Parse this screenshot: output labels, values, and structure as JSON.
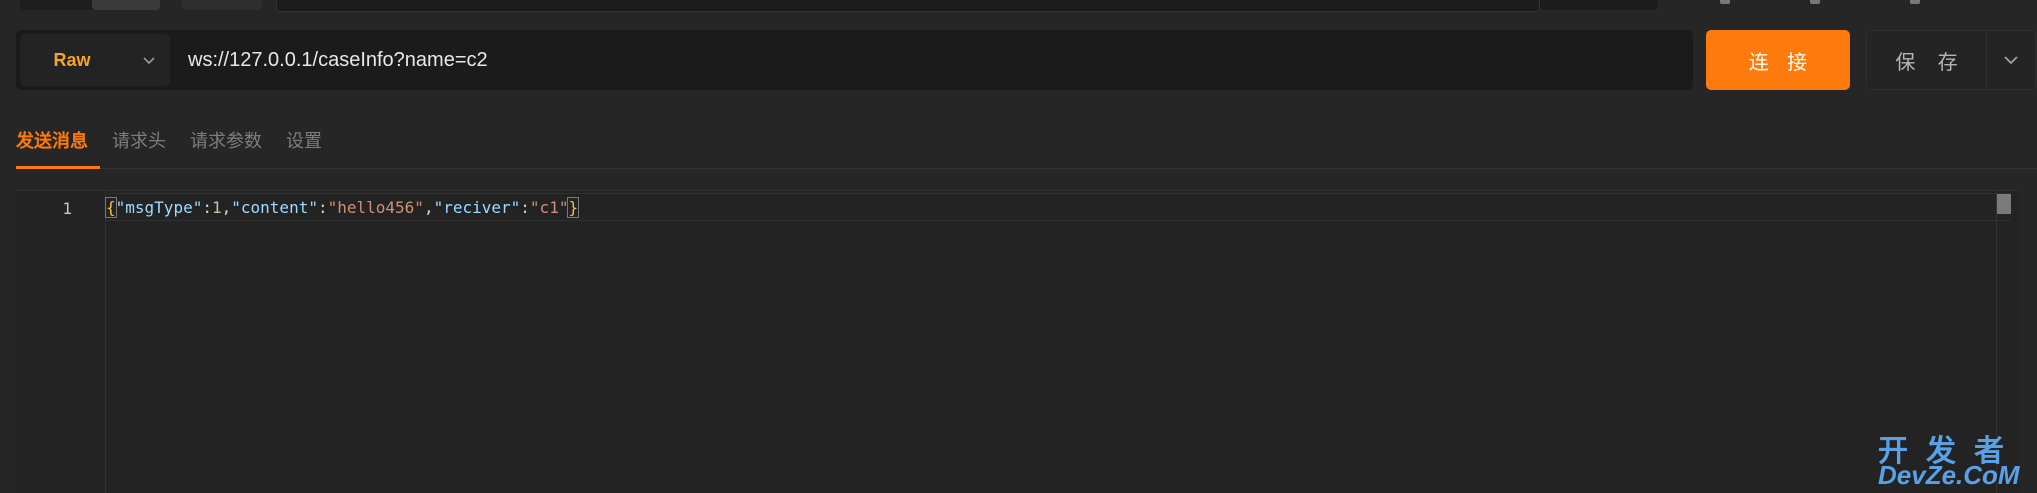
{
  "request": {
    "method": "Raw",
    "url": "ws://127.0.0.1/caseInfo?name=c2",
    "connect_label": "连 接",
    "save_label": "保 存"
  },
  "tabs": [
    {
      "label": "发送消息",
      "active": true
    },
    {
      "label": "请求头",
      "active": false
    },
    {
      "label": "请求参数",
      "active": false
    },
    {
      "label": "设置",
      "active": false
    }
  ],
  "editor": {
    "line_number": "1",
    "tokens": {
      "open": "{",
      "k1": "\"msgType\"",
      "c1": ":",
      "v1": "1",
      "s1": ",",
      "k2": "\"content\"",
      "c2": ":",
      "v2": "\"hello456\"",
      "s2": ",",
      "k3": "\"reciver\"",
      "c3": ":",
      "v3": "\"c1\"",
      "close": "}"
    }
  },
  "watermark": {
    "top": "开发者",
    "bottom": "DevZe.CoM"
  },
  "colors": {
    "accent": "#ff7a0c",
    "method": "#f5a524",
    "background": "#262626"
  }
}
